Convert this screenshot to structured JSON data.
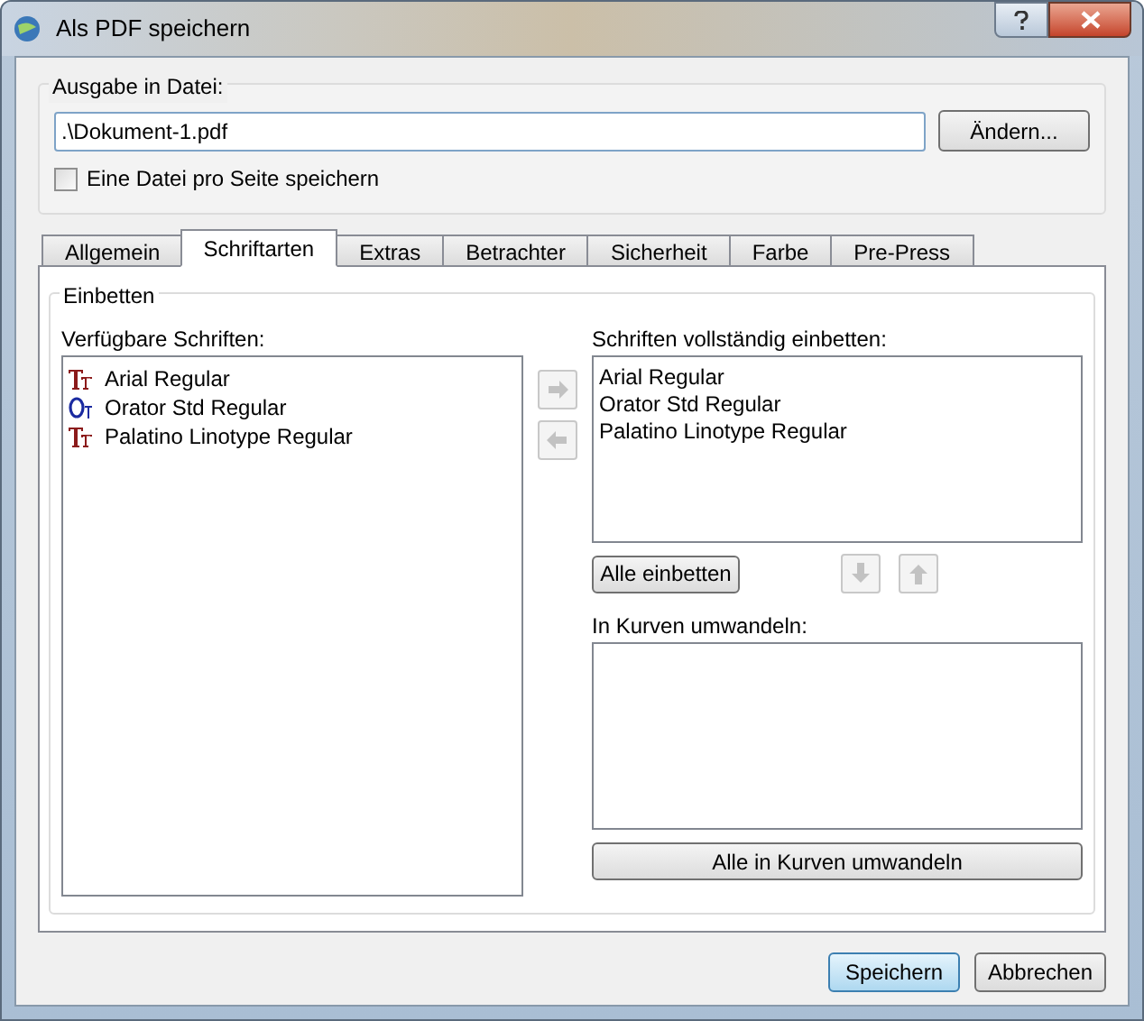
{
  "window": {
    "title": "Als PDF speichern"
  },
  "output": {
    "label": "Ausgabe in Datei:",
    "path": ".\\Dokument-1.pdf",
    "change_button": {
      "label": "Ändern..."
    },
    "per_page": {
      "label": "Eine Datei pro Seite speichern",
      "checked": false
    }
  },
  "tabs": [
    {
      "label": "Allgemein",
      "selected": false
    },
    {
      "label": "Schriftarten",
      "selected": true
    },
    {
      "label": "Extras",
      "selected": false
    },
    {
      "label": "Betrachter",
      "selected": false
    },
    {
      "label": "Sicherheit",
      "selected": false
    },
    {
      "label": "Farbe",
      "selected": false
    },
    {
      "label": "Pre-Press",
      "selected": false
    }
  ],
  "embed": {
    "title": "Einbetten",
    "available": {
      "label": "Verfügbare Schriften:",
      "items": [
        {
          "name": "Arial Regular",
          "kind": "truetype"
        },
        {
          "name": "Orator Std Regular",
          "kind": "opentype"
        },
        {
          "name": "Palatino Linotype Regular",
          "kind": "truetype"
        }
      ]
    },
    "move_buttons": [
      {
        "kind": "right",
        "disabled": true
      },
      {
        "kind": "left",
        "disabled": true
      }
    ],
    "full": {
      "label": "Schriften vollständig einbetten:",
      "items": [
        "Arial Regular",
        "Orator Std Regular",
        "Palatino Linotype Regular"
      ]
    },
    "embed_all": {
      "label": "Alle einbetten"
    },
    "order_buttons": [
      {
        "kind": "down",
        "disabled": true
      },
      {
        "kind": "up",
        "disabled": true
      }
    ],
    "curves": {
      "label": "In Kurven umwandeln:"
    },
    "curves_all": {
      "label": "Alle in Kurven umwandeln"
    }
  },
  "buttons": [
    {
      "label": "Speichern",
      "default": true
    },
    {
      "label": "Abbrechen",
      "default": false
    }
  ]
}
